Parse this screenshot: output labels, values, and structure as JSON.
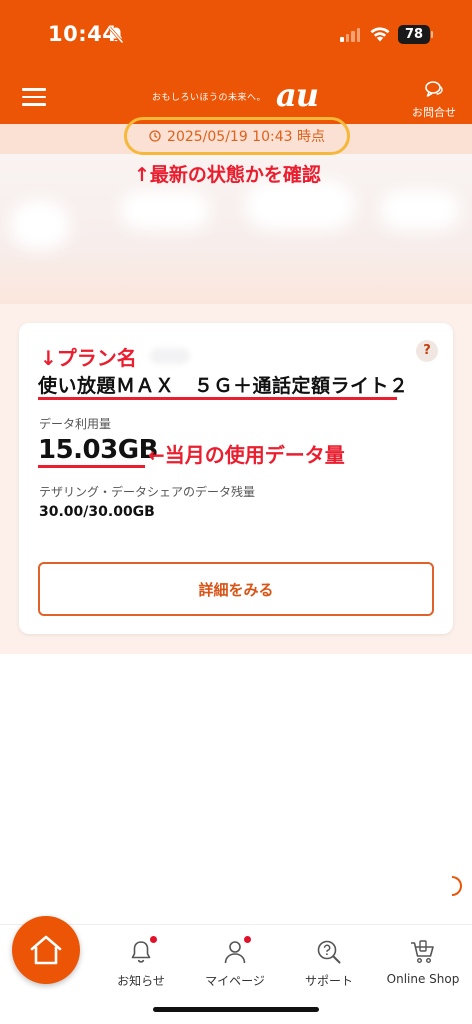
{
  "status_bar": {
    "time": "10:44",
    "battery": "78"
  },
  "header": {
    "tagline": "おもしろいほうの未来へ。",
    "logo": "au",
    "contact_label": "お問合せ"
  },
  "timestamp": {
    "text": "2025/05/19 10:43 時点"
  },
  "annotations": {
    "latest": "↑最新の状態かを確認",
    "plan": "↓プラン名",
    "usage": "←当月の使用データ量"
  },
  "card": {
    "plan_name": "使い放題ＭＡＸ　５Ｇ＋通話定額ライト２",
    "usage_label": "データ利用量",
    "usage_value": "15.03GB",
    "tether_label": "テザリング・データシェアのデータ残量",
    "tether_value": "30.00/30.00GB",
    "detail_button": "詳細をみる",
    "help": "?"
  },
  "bottom_nav": {
    "items": [
      {
        "label": "お知らせ"
      },
      {
        "label": "マイページ"
      },
      {
        "label": "サポート"
      },
      {
        "label": "Online Shop"
      }
    ]
  },
  "colors": {
    "brand": "#eb5505",
    "annotation": "#ea1e2e",
    "highlight": "#f5b83a"
  }
}
